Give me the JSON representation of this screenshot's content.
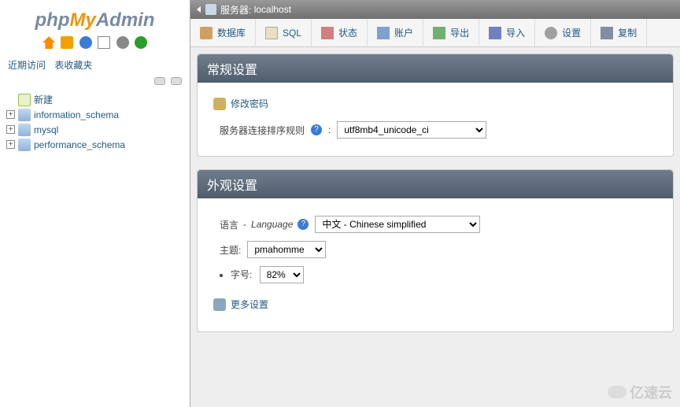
{
  "logo": {
    "part1": "php",
    "part2": "My",
    "part3": "Admin"
  },
  "sidebar": {
    "tabs": {
      "recent": "近期访问",
      "favorites": "表收藏夹"
    },
    "new_label": "新建",
    "dbs": [
      "information_schema",
      "mysql",
      "performance_schema"
    ]
  },
  "breadcrumb": {
    "server_label": "服务器:",
    "server_value": "localhost"
  },
  "toolbar": {
    "db": "数据库",
    "sql": "SQL",
    "status": "状态",
    "accounts": "账户",
    "export": "导出",
    "import": "导入",
    "settings": "设置",
    "replication": "复制"
  },
  "panels": {
    "general_title": "常规设置",
    "appearance_title": "外观设置"
  },
  "general": {
    "change_pw": "修改密码",
    "collation_label": "服务器连接排序规则",
    "collation_value": "utf8mb4_unicode_ci"
  },
  "appearance": {
    "lang_label": "语言",
    "lang_lang": "Language",
    "lang_value": "中文 - Chinese simplified",
    "theme_label": "主题:",
    "theme_value": "pmahomme",
    "fontsize_label": "字号:",
    "fontsize_value": "82%",
    "more_settings": "更多设置"
  },
  "watermark": "亿速云"
}
